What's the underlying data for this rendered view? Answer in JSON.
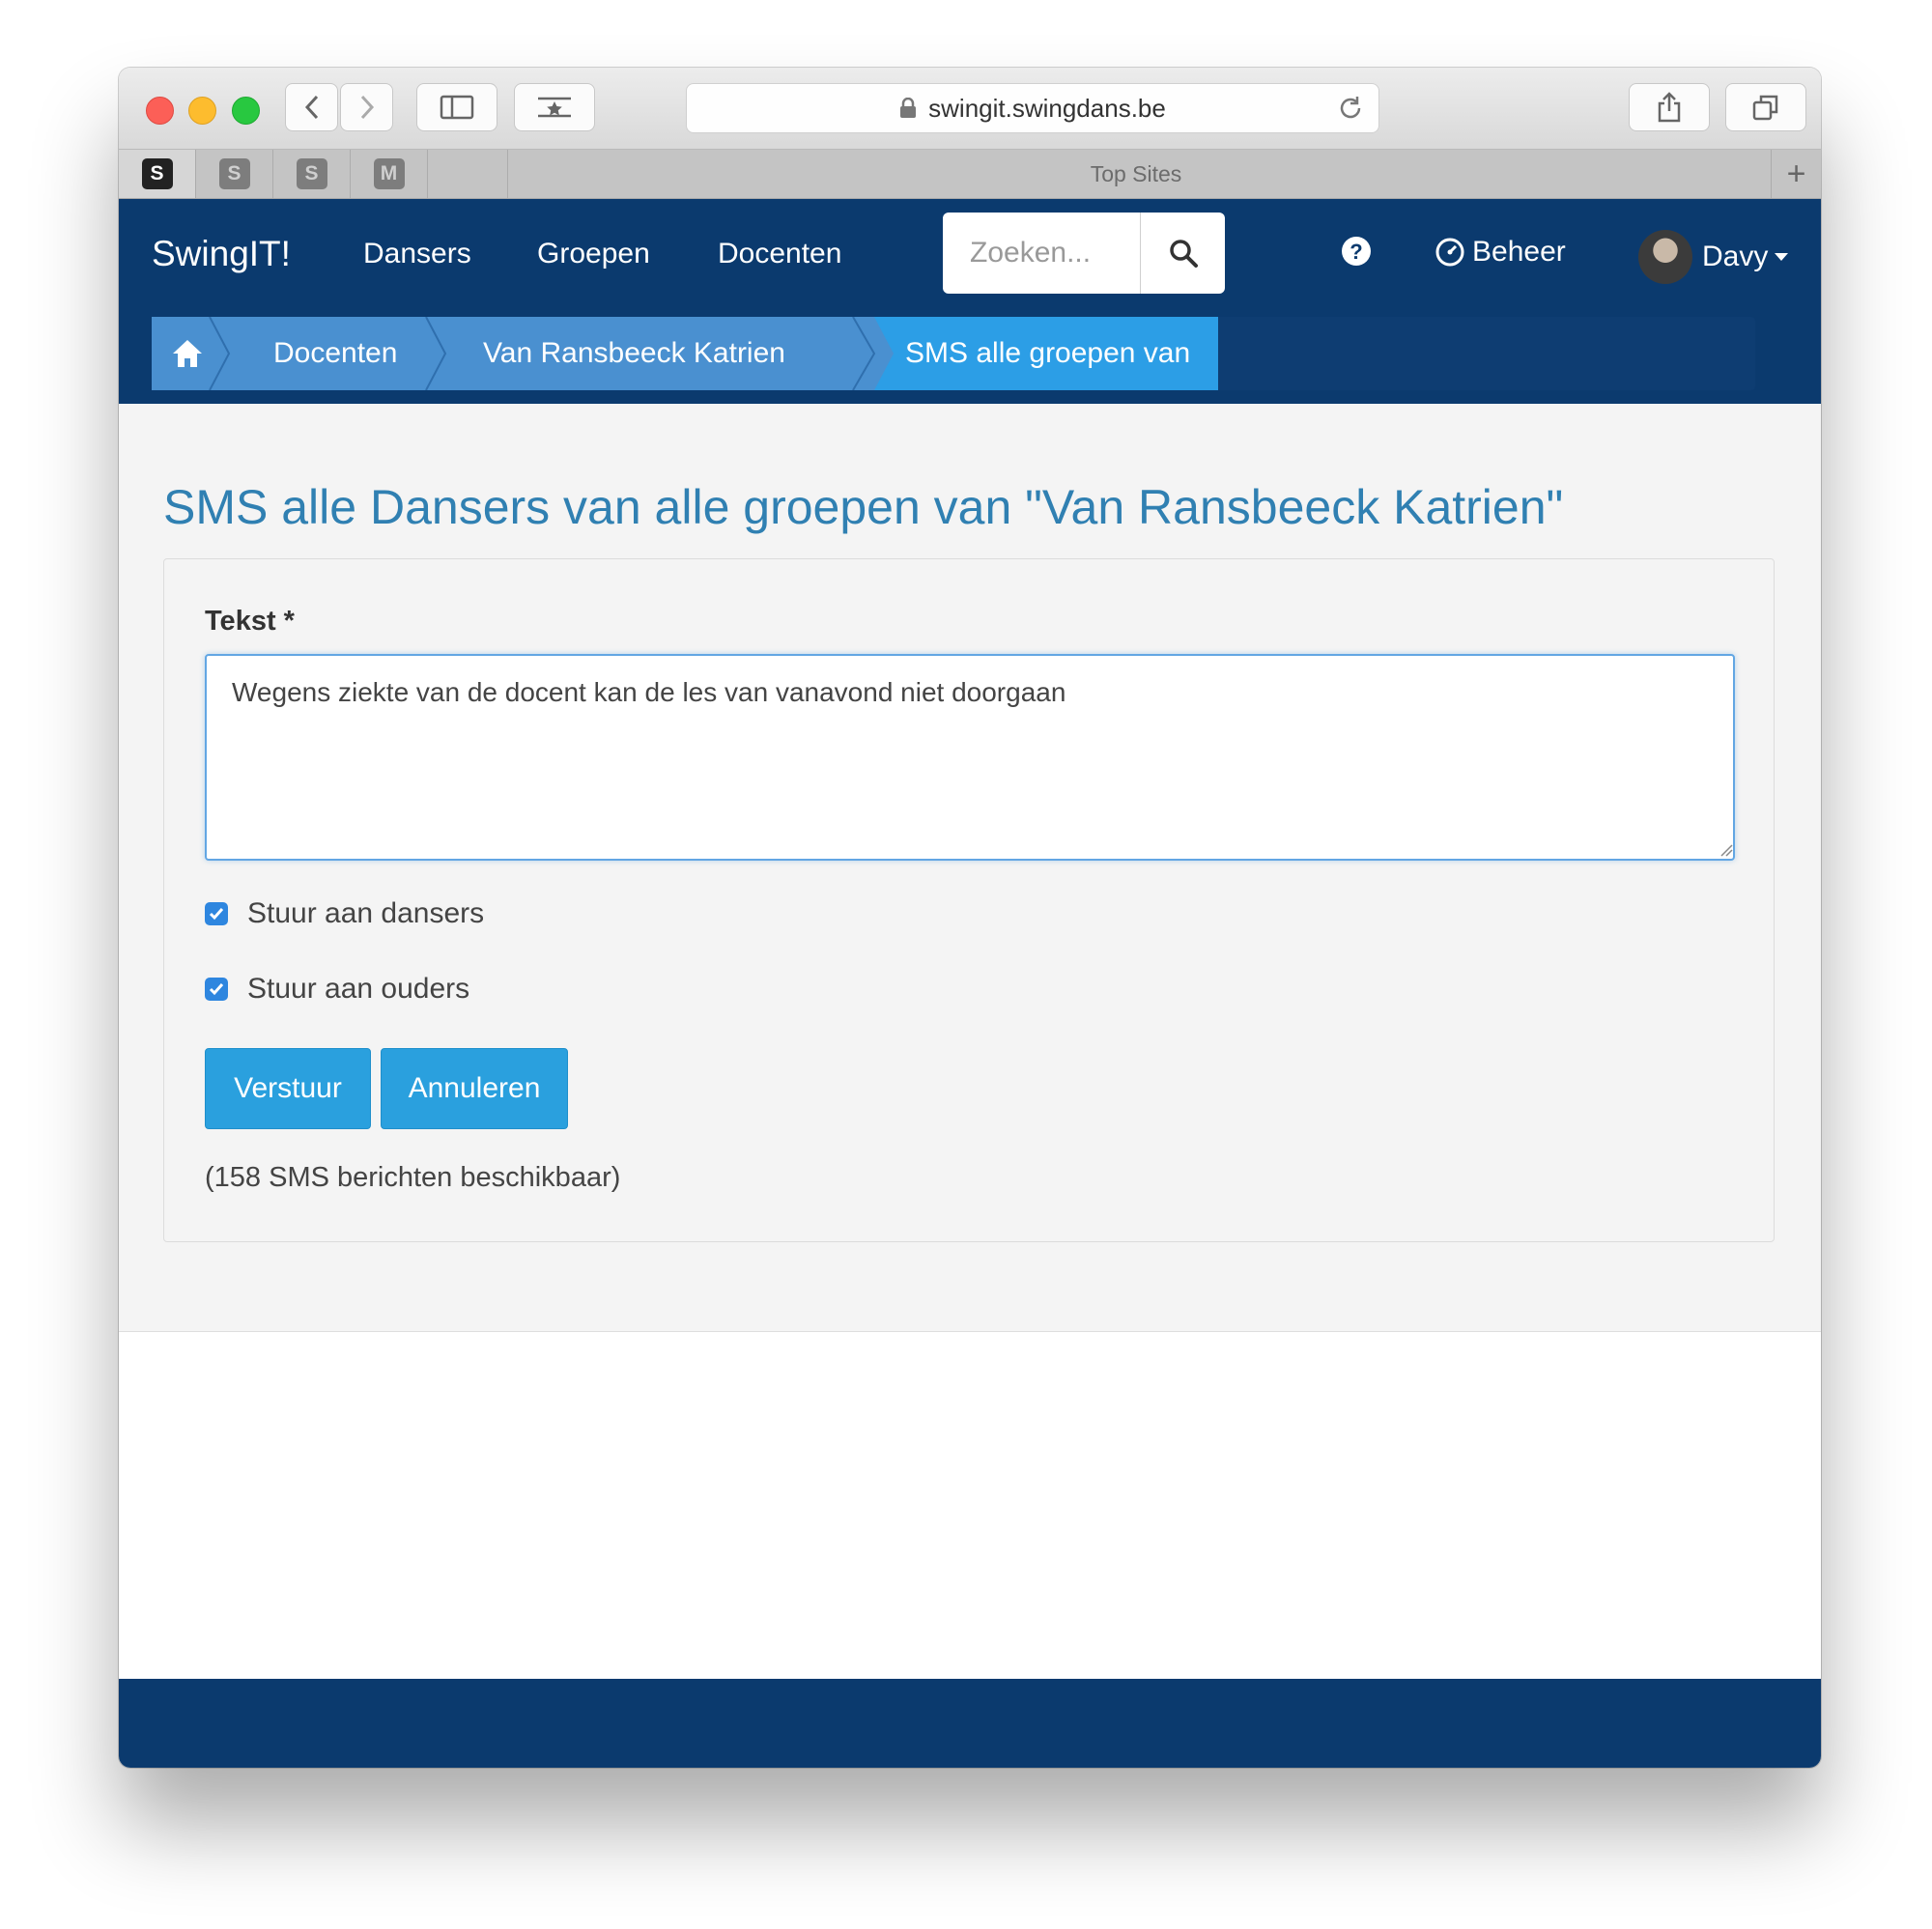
{
  "browser": {
    "url": "swingit.swingdans.be",
    "favorites": [
      "S",
      "S",
      "S",
      "M"
    ],
    "tab_title": "Top Sites",
    "new_tab": "+"
  },
  "nav": {
    "brand": "SwingIT!",
    "links": [
      "Dansers",
      "Groepen",
      "Docenten"
    ],
    "search_placeholder": "Zoeken...",
    "beheer": "Beheer",
    "user": "Davy"
  },
  "breadcrumb": [
    "Docenten",
    "Van Ransbeeck Katrien",
    "SMS alle groepen van"
  ],
  "page": {
    "title": "SMS alle Dansers van alle groepen van \"Van Ransbeeck Katrien\"",
    "field_label": "Tekst *",
    "text_value": "Wegens ziekte van de docent kan de les van vanavond niet doorgaan",
    "checkboxes": [
      {
        "label": "Stuur aan dansers",
        "checked": true
      },
      {
        "label": "Stuur aan ouders",
        "checked": true
      }
    ],
    "buttons": {
      "send": "Verstuur",
      "cancel": "Annuleren"
    },
    "sms_available": "(158 SMS berichten beschikbaar)"
  },
  "colors": {
    "navbar": "#0b3a6e",
    "accent": "#2aa0de",
    "title": "#3080b2"
  }
}
